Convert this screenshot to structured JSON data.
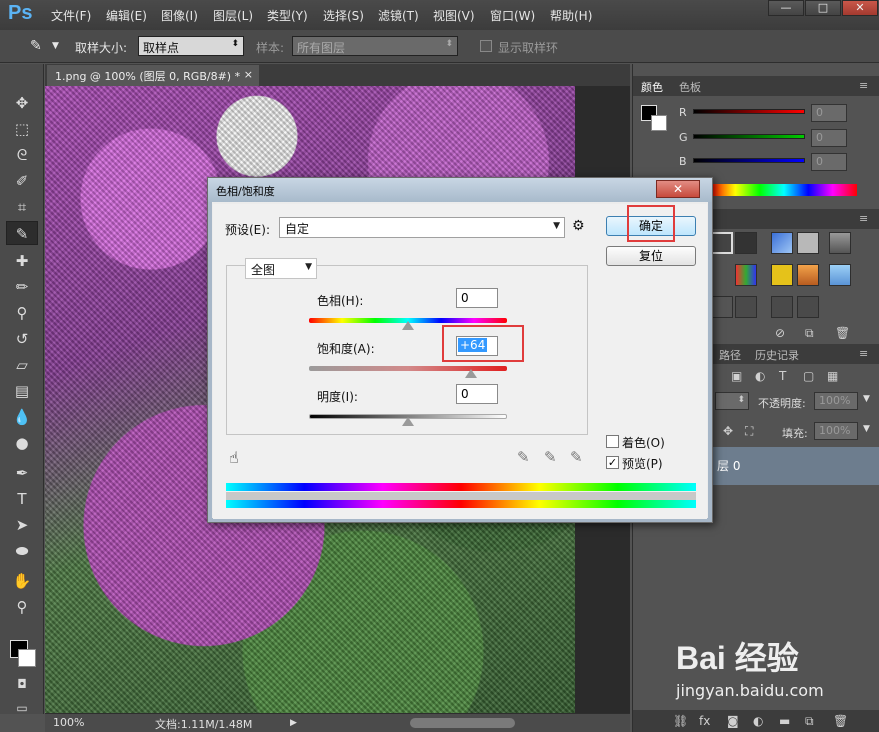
{
  "app": {
    "logo": "Ps"
  },
  "menu": [
    "文件(F)",
    "编辑(E)",
    "图像(I)",
    "图层(L)",
    "类型(Y)",
    "选择(S)",
    "滤镜(T)",
    "视图(V)",
    "窗口(W)",
    "帮助(H)"
  ],
  "window_controls": {
    "minimize": "—",
    "maximize": "□",
    "close": "✕"
  },
  "options_bar": {
    "sample_size_label": "取样大小:",
    "sample_size_value": "取样点",
    "sample_label": "样本:",
    "sample_value": "所有图层",
    "show_ring_label": "显示取样环"
  },
  "document": {
    "tab_title": "1.png @ 100% (图层 0, RGB/8#) *",
    "tab_close": "×"
  },
  "statusbar": {
    "zoom": "100%",
    "doc_info": "文档:1.11M/1.48M"
  },
  "panels": {
    "color_tabs": [
      "颜色",
      "色板"
    ],
    "channels": [
      "R",
      "G",
      "B"
    ],
    "channel_values": [
      "0",
      "0",
      "0"
    ],
    "layers_tabs": [
      "路径",
      "历史记录"
    ],
    "opacity_label": "不透明度:",
    "opacity_value": "100%",
    "fill_label": "填充:",
    "fill_value": "100%",
    "layer_name": "层 0"
  },
  "dialog": {
    "title": "色相/饱和度",
    "close": "✕",
    "preset_label": "预设(E):",
    "preset_value": "自定",
    "ok_button": "确定",
    "reset_button": "复位",
    "channel_value": "全图",
    "hue_label": "色相(H):",
    "hue_value": "0",
    "hue": 0,
    "saturation_label": "饱和度(A):",
    "saturation_value": "+64",
    "saturation": 64,
    "lightness_label": "明度(I):",
    "lightness_value": "0",
    "lightness": 0,
    "colorize_label": "着色(O)",
    "colorize_checked": false,
    "preview_label": "预览(P)",
    "preview_checked": true
  },
  "watermark": {
    "brand": "Bai 经验",
    "url": "jingyan.baidu.com"
  },
  "colors": {
    "highlight": "#e03c3c",
    "ps_blue": "#5bb4f5",
    "dialog_frame": "#a7b7c8"
  }
}
